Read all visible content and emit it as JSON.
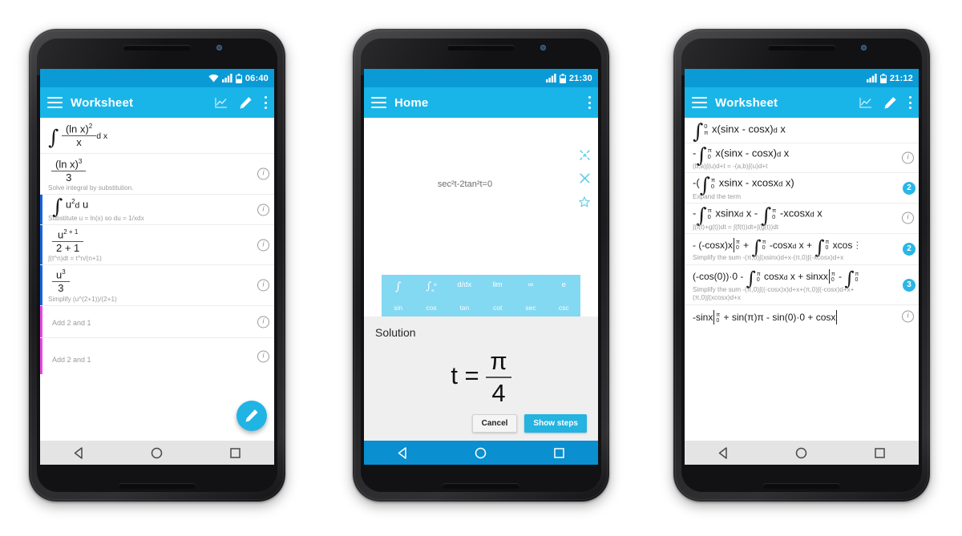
{
  "colors": {
    "status_bar": "#0a9ad6",
    "app_bar": "#19b5e8",
    "accent": "#29b6e8",
    "fab": "#20b4e4",
    "stripe_blue": "#1565e0",
    "stripe_magenta": "#e848e0",
    "keyboard": "#83d8f2",
    "dialog_bg": "#efefef"
  },
  "phone1": {
    "status": {
      "time": "06:40",
      "icons": [
        "wifi-icon",
        "signal-icon",
        "battery-icon"
      ]
    },
    "appbar": {
      "title": "Worksheet",
      "menu_icon": "hamburger-icon",
      "actions": [
        "graph-icon",
        "pencil-icon",
        "overflow-icon"
      ]
    },
    "fab_icon": "pencil-icon",
    "rows": [
      {
        "math": "integral-ln-x-squared-over-x-dx",
        "hint": "",
        "info": false,
        "badge": null,
        "stripe": "none"
      },
      {
        "math": "ln-x-cubed-over-3",
        "hint": "Solve integral by substitution.",
        "info": true,
        "badge": null,
        "stripe": "none"
      },
      {
        "math": "integral-u-squared-du",
        "hint": "Substitute u = ln(x) so du = 1/xdx",
        "info": true,
        "badge": null,
        "stripe": "blue"
      },
      {
        "math": "u-pow-2-plus-1-over-2-plus-1",
        "hint": "∫(t^n)dt = t^n/(n+1)",
        "info": true,
        "badge": null,
        "stripe": "blue"
      },
      {
        "math": "u-cubed-over-3",
        "hint": "Simplify (u^(2+1))/(2+1)",
        "info": true,
        "badge": null,
        "stripe": "blue"
      },
      {
        "math": "",
        "hint": "Add 2 and 1",
        "info": true,
        "badge": null,
        "stripe": "magenta"
      },
      {
        "math": "",
        "hint": "Add 2 and 1",
        "info": true,
        "badge": null,
        "stripe": "magenta"
      }
    ],
    "nav": {
      "back": "back-icon",
      "home": "home-icon",
      "recents": "recents-icon"
    }
  },
  "phone2": {
    "status": {
      "time": "21:30",
      "icons": [
        "signal-icon",
        "battery-icon"
      ]
    },
    "appbar": {
      "title": "Home",
      "menu_icon": "hamburger-icon",
      "actions": [
        "overflow-icon"
      ]
    },
    "equation": "sec²t-2tan²t=0",
    "equation_icons": [
      "shuffle-icon",
      "close-icon",
      "star-icon"
    ],
    "keyboard": {
      "row1": [
        "∫",
        "∫ a b",
        "d/dx",
        "lim",
        "∞",
        "e"
      ],
      "row2": [
        "sin",
        "cos",
        "tan",
        "cot",
        "sec",
        "csc"
      ]
    },
    "dialog": {
      "title": "Solution",
      "solution_lhs": "t =",
      "solution_num": "π",
      "solution_den": "4",
      "cancel_label": "Cancel",
      "show_steps_label": "Show steps"
    },
    "nav": {
      "back": "back-icon",
      "home": "home-icon",
      "recents": "recents-icon"
    }
  },
  "phone3": {
    "status": {
      "time": "21:12",
      "icons": [
        "signal-icon",
        "battery-icon"
      ]
    },
    "appbar": {
      "title": "Worksheet",
      "menu_icon": "hamburger-icon",
      "actions": [
        "graph-icon",
        "pencil-icon",
        "overflow-icon"
      ]
    },
    "rows": [
      {
        "hint": "",
        "info": false,
        "badge": null
      },
      {
        "hint": "(b,a)∫(u)d+t = -(a,b)∫(u)d+t",
        "info": true,
        "badge": null
      },
      {
        "hint": "Expand the term",
        "info": true,
        "badge": "2"
      },
      {
        "hint": "∫(f(t)+g(t))dt = ∫(f(t))dt+∫(g(t))dt",
        "info": true,
        "badge": null
      },
      {
        "hint": "Simplify the sum -(π,0)∫(xsinx)d+x-(π,0)∫(-xcosx)d+x",
        "info": true,
        "badge": "2"
      },
      {
        "hint": "Simplify the sum -(π,0)∫((-cosx)x)d+x+(π,0)∫(-cosx)d+x+(π,0)∫(xcosx)d+x",
        "info": true,
        "badge": "3"
      },
      {
        "hint": "",
        "info": true,
        "badge": null
      }
    ],
    "nav": {
      "back": "back-icon",
      "home": "home-icon",
      "recents": "recents-icon"
    }
  }
}
